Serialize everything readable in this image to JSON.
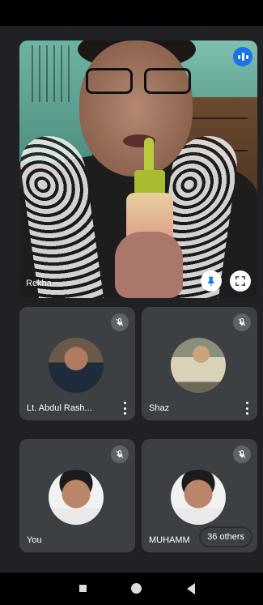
{
  "main_speaker": {
    "name": "Rekha",
    "audio_indicator_icon": "audio-level-icon",
    "pin_icon": "pin-icon",
    "fullscreen_icon": "fullscreen-icon"
  },
  "participants": [
    {
      "name": "Lt. Abdul Rash...",
      "muted": true,
      "icon": "mic-off-icon"
    },
    {
      "name": "Shaz",
      "muted": true,
      "icon": "mic-off-icon"
    },
    {
      "name": "You",
      "muted": true,
      "icon": "mic-off-icon"
    },
    {
      "name": "MUHAMM",
      "muted": true,
      "icon": "mic-off-icon"
    }
  ],
  "others_label": "36 others",
  "nav": {
    "recent_icon": "recents-square-icon",
    "home_icon": "home-circle-icon",
    "back_icon": "back-triangle-icon"
  },
  "colors": {
    "background": "#202124",
    "tile": "#3c4043",
    "accent": "#1a73e8"
  }
}
